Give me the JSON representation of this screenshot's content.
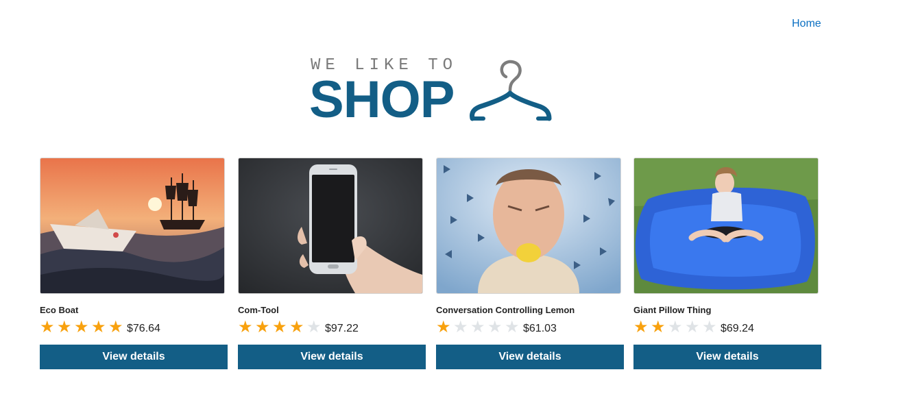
{
  "nav": {
    "home_label": "Home"
  },
  "logo": {
    "tagline": "WE LIKE TO",
    "word": "SHOP",
    "icon": "hanger-icon",
    "brand_color": "#135e86"
  },
  "products": [
    {
      "title": "Eco Boat",
      "rating": 5,
      "price": "$76.64",
      "button": "View details",
      "image": "sunset-ship-paper-boat"
    },
    {
      "title": "Com-Tool",
      "rating": 4,
      "price": "$97.22",
      "button": "View details",
      "image": "hand-holding-phone"
    },
    {
      "title": "Conversation Controlling Lemon",
      "rating": 1,
      "price": "$61.03",
      "button": "View details",
      "image": "man-biting-lemon"
    },
    {
      "title": "Giant Pillow Thing",
      "rating": 2,
      "price": "$69.24",
      "button": "View details",
      "image": "girl-on-blue-beanbag"
    }
  ],
  "colors": {
    "button": "#135e86",
    "star_on": "#f8a10e",
    "star_off": "#dfe3e6",
    "link": "#0a6fc2"
  }
}
